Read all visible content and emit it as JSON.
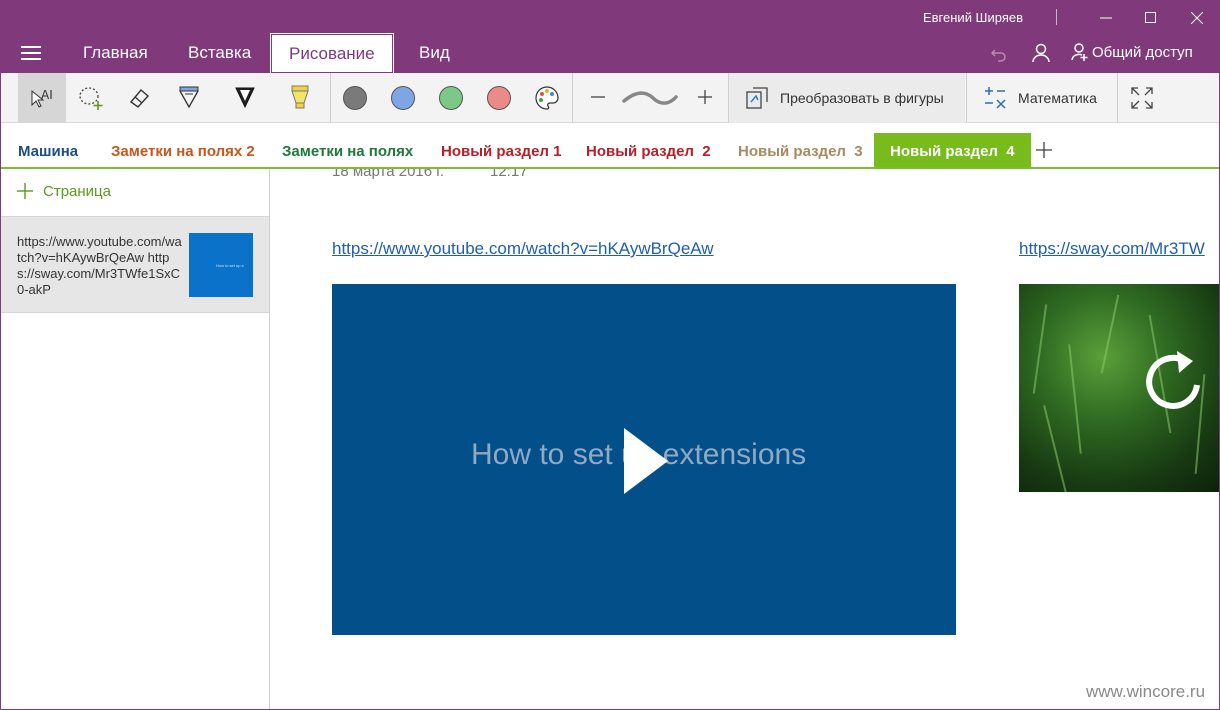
{
  "window": {
    "user_name": "Евгений Ширяев"
  },
  "ribbon": {
    "tabs": [
      "Главная",
      "Вставка",
      "Рисование",
      "Вид"
    ],
    "active_tab": "Рисование",
    "share_label": "Общий доступ"
  },
  "toolbar": {
    "tools": [
      "text-select-icon",
      "lasso-select-icon",
      "eraser-icon",
      "pen-icon",
      "felt-pen-icon",
      "highlighter-icon"
    ],
    "colors": [
      "#7a7a7a",
      "#7ea6e6",
      "#7cc887",
      "#ec8a8a"
    ],
    "convert_label": "Преобразовать в фигуры",
    "math_label": "Математика"
  },
  "sections": [
    {
      "label": "Машина",
      "color": "#1c4e82"
    },
    {
      "label": "Заметки на полях 2",
      "color": "#c8561c"
    },
    {
      "label": "Заметки на полях",
      "color": "#1f7a3a"
    },
    {
      "label": "Новый раздел 1",
      "color": "#b51f2a"
    },
    {
      "label": "Новый раздел  2",
      "color": "#b51f2a"
    },
    {
      "label": "Новый раздел  3",
      "color": "#a88a62"
    },
    {
      "label": "Новый раздел  4",
      "color": "#78bb1c"
    }
  ],
  "pages": {
    "add_label": "Страница",
    "items": [
      {
        "title": "https://www.youtube.com/watch?v=hKAywBrQeAw https://sway.com/Mr3TWfe1SxC0-akP",
        "thumb_text": "How to set up e"
      }
    ]
  },
  "content": {
    "date": "18 марта 2016 г.",
    "time": "12:17",
    "link1": "https://www.youtube.com/watch?v=hKAywBrQeAw",
    "link2": "https://sway.com/Mr3TW",
    "video_title": "How to set up extensions"
  },
  "watermark": "www.wincore.ru"
}
